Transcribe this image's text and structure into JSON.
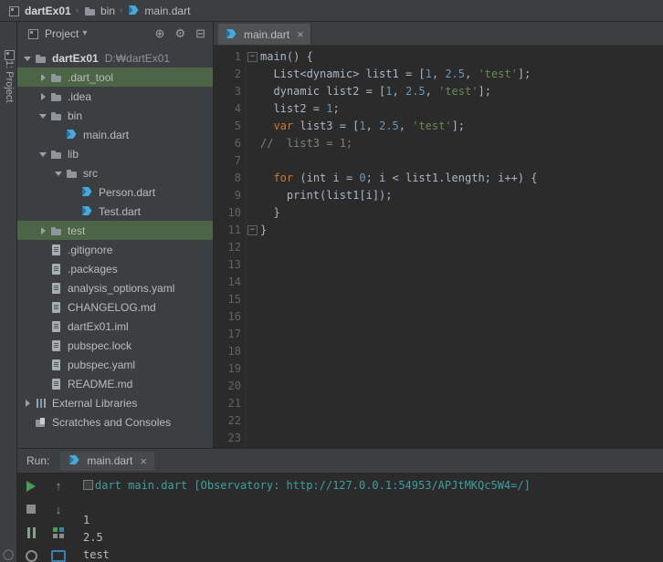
{
  "navbar": {
    "separator": "›",
    "items": [
      {
        "label": "dartEx01",
        "icon": "module-icon"
      },
      {
        "label": "bin",
        "icon": "folder-icon"
      },
      {
        "label": "main.dart",
        "icon": "dart-icon"
      }
    ]
  },
  "tool_strip": {
    "label": "1: Project"
  },
  "project": {
    "header": {
      "title": "Project",
      "caret": "▾",
      "icons": [
        {
          "name": "locate-icon",
          "glyph": "⊕"
        },
        {
          "name": "gear-icon",
          "glyph": "⚙"
        },
        {
          "name": "collapse-icon",
          "glyph": "⊟"
        }
      ]
    },
    "tree": [
      {
        "label": "dartEx01",
        "suffix": "D:₩dartEx01",
        "level": 0,
        "chevron": "down",
        "icon": "folder-icon",
        "bold": true
      },
      {
        "label": ".dart_tool",
        "level": 1,
        "chevron": "right",
        "icon": "folder-icon",
        "selected": true
      },
      {
        "label": ".idea",
        "level": 1,
        "chevron": "right",
        "icon": "folder-icon"
      },
      {
        "label": "bin",
        "level": 1,
        "chevron": "down",
        "icon": "folder-icon"
      },
      {
        "label": "main.dart",
        "level": 2,
        "icon": "dart-icon"
      },
      {
        "label": "lib",
        "level": 1,
        "chevron": "down",
        "icon": "folder-icon"
      },
      {
        "label": "src",
        "level": 2,
        "chevron": "down",
        "icon": "folder-icon"
      },
      {
        "label": "Person.dart",
        "level": 3,
        "icon": "dart-icon"
      },
      {
        "label": "Test.dart",
        "level": 3,
        "icon": "dart-icon"
      },
      {
        "label": "test",
        "level": 1,
        "chevron": "right",
        "icon": "folder-icon",
        "selected": true
      },
      {
        "label": ".gitignore",
        "level": 1,
        "icon": "file-icon"
      },
      {
        "label": ".packages",
        "level": 1,
        "icon": "file-icon"
      },
      {
        "label": "analysis_options.yaml",
        "level": 1,
        "icon": "file-icon"
      },
      {
        "label": "CHANGELOG.md",
        "level": 1,
        "icon": "file-icon"
      },
      {
        "label": "dartEx01.iml",
        "level": 1,
        "icon": "file-icon"
      },
      {
        "label": "pubspec.lock",
        "level": 1,
        "icon": "file-icon"
      },
      {
        "label": "pubspec.yaml",
        "level": 1,
        "icon": "file-icon"
      },
      {
        "label": "README.md",
        "level": 1,
        "icon": "file-icon"
      },
      {
        "label": "External Libraries",
        "level": 0,
        "chevron": "right",
        "icon": "library-icon"
      },
      {
        "label": "Scratches and Consoles",
        "level": 0,
        "icon": "scratches-icon"
      }
    ]
  },
  "editor": {
    "tab": {
      "label": "main.dart",
      "close": "×",
      "icon": "dart-icon"
    },
    "line_count": 23,
    "fold_lines": [
      1,
      11
    ],
    "code": [
      [
        [
          "pl",
          "main() {"
        ]
      ],
      [
        [
          "pl",
          "  List<dynamic> list1 = ["
        ],
        [
          "num",
          "1"
        ],
        [
          "pl",
          ", "
        ],
        [
          "num",
          "2.5"
        ],
        [
          "pl",
          ", "
        ],
        [
          "str",
          "'test'"
        ],
        [
          "pl",
          "];"
        ]
      ],
      [
        [
          "pl",
          "  dynamic list2 = ["
        ],
        [
          "num",
          "1"
        ],
        [
          "pl",
          ", "
        ],
        [
          "num",
          "2.5"
        ],
        [
          "pl",
          ", "
        ],
        [
          "str",
          "'test'"
        ],
        [
          "pl",
          "];"
        ]
      ],
      [
        [
          "pl",
          "  list2 = "
        ],
        [
          "num",
          "1"
        ],
        [
          "pl",
          ";"
        ]
      ],
      [
        [
          "pl",
          "  "
        ],
        [
          "kw",
          "var"
        ],
        [
          "pl",
          " list3 = ["
        ],
        [
          "num",
          "1"
        ],
        [
          "pl",
          ", "
        ],
        [
          "num",
          "2.5"
        ],
        [
          "pl",
          ", "
        ],
        [
          "str",
          "'test'"
        ],
        [
          "pl",
          "];"
        ]
      ],
      [
        [
          "cmt",
          "//  list3 = 1;"
        ]
      ],
      [],
      [
        [
          "pl",
          "  "
        ],
        [
          "kw",
          "for"
        ],
        [
          "pl",
          " (int i = "
        ],
        [
          "num",
          "0"
        ],
        [
          "pl",
          "; i < list1.length; i++) {"
        ]
      ],
      [
        [
          "pl",
          "    print(list1[i]);"
        ]
      ],
      [
        [
          "pl",
          "  }"
        ]
      ],
      [
        [
          "pl",
          "}"
        ]
      ],
      [],
      [],
      [],
      [],
      [],
      [],
      [],
      [],
      [],
      [],
      [],
      []
    ]
  },
  "run": {
    "label": "Run:",
    "tab": {
      "label": "main.dart",
      "close": "×",
      "icon": "dart-icon"
    },
    "toolbar_left": [
      "run-icon",
      "stop-icon",
      "pause-icon",
      "circle-icon"
    ],
    "toolbar_right": [
      {
        "name": "up-icon",
        "glyph": "↑"
      },
      {
        "name": "down-icon",
        "glyph": "↓"
      },
      {
        "name": "layout-icon"
      },
      {
        "name": "monitor-icon"
      }
    ],
    "console": {
      "command": "dart main.dart [Observatory: http://127.0.0.1:54953/APJtMKQc5W4=/]",
      "output": [
        "1",
        "2.5",
        "test"
      ]
    }
  },
  "colors": {
    "panel_bg": "#3c3f41",
    "editor_bg": "#2b2b2b",
    "selection_green": "#4b6546",
    "keyword": "#cc7832",
    "number": "#6897bb",
    "string": "#6a8759",
    "comment": "#808080",
    "plain_code": "#a9b7c6",
    "console_command": "#3f9e9e",
    "run_green": "#499c54"
  }
}
